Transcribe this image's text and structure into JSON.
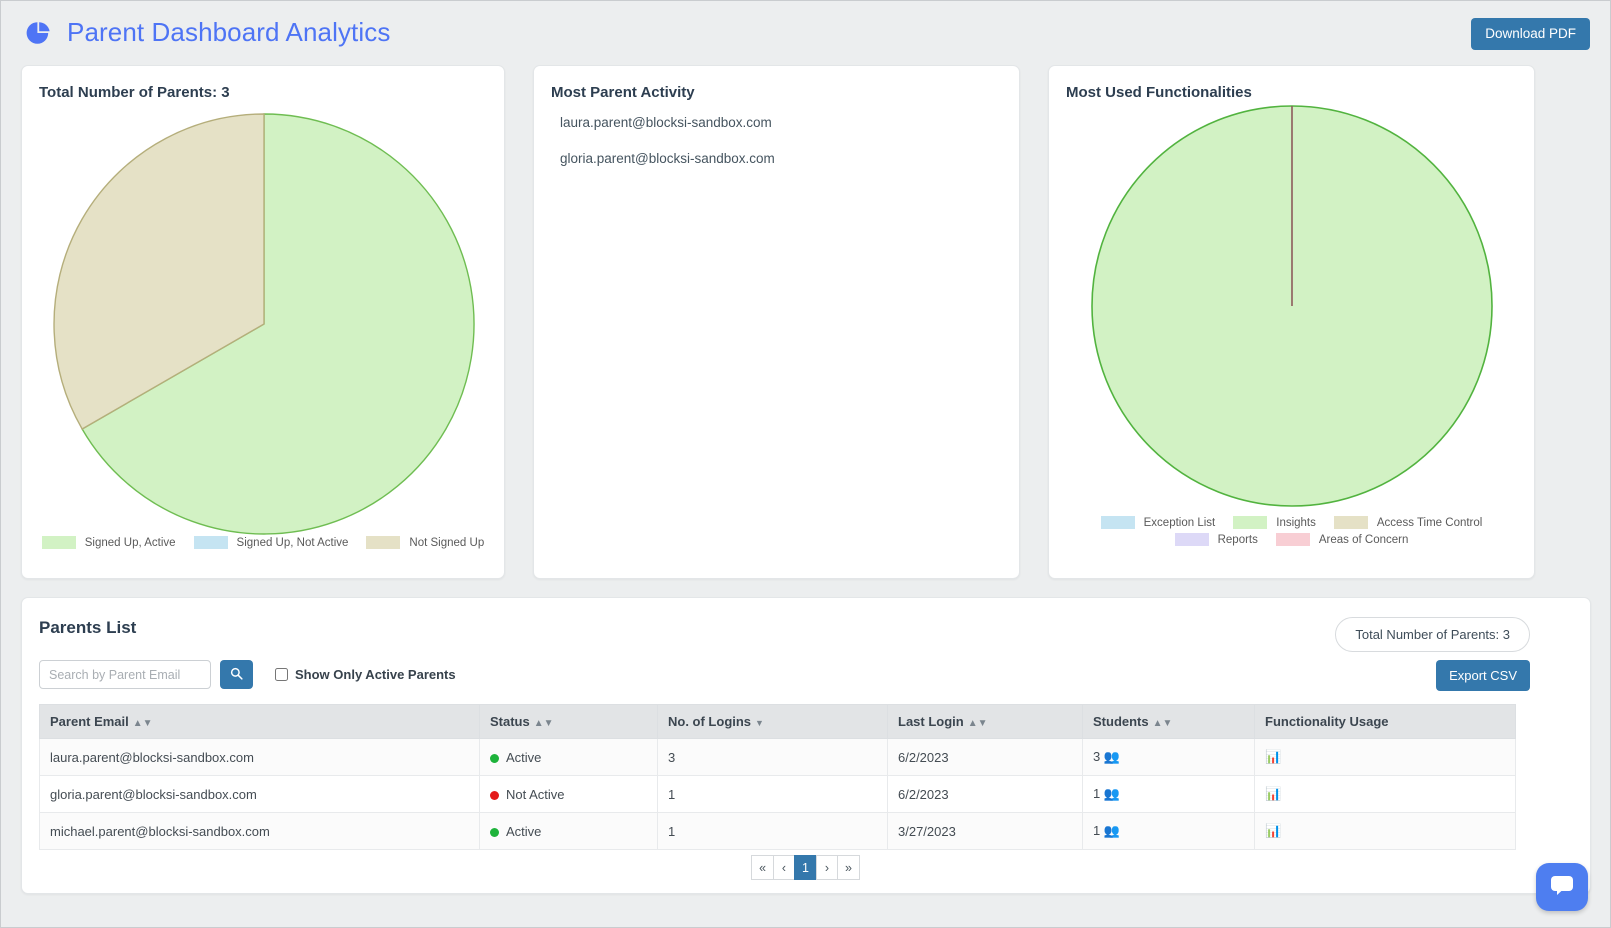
{
  "header": {
    "title": "Parent Dashboard Analytics",
    "brand_icon": "pie-chart-icon",
    "download_pdf_label": "Download PDF",
    "title_color": "#4e74f5",
    "button_color": "#3478ac"
  },
  "cards": {
    "parents_pie": {
      "title": "Total Number of Parents: 3"
    },
    "activity": {
      "title": "Most Parent Activity",
      "items": [
        "laura.parent@blocksi-sandbox.com",
        "gloria.parent@blocksi-sandbox.com"
      ]
    },
    "functionalities_pie": {
      "title": "Most Used Functionalities"
    }
  },
  "chart_data": [
    {
      "type": "pie",
      "title": "Total Number of Parents: 3",
      "labels": [
        "Signed Up, Active",
        "Signed Up, Not Active",
        "Not Signed Up"
      ],
      "values": [
        2,
        0,
        1
      ],
      "percentages": [
        66.7,
        0,
        33.3
      ],
      "colors": [
        "#d2f2c4",
        "#c5e4f2",
        "#e5e1c6"
      ],
      "border_colors": [
        "#6fbd52",
        "#6aa9c9",
        "#b5ae7b"
      ],
      "legend_position": "bottom",
      "total": 3
    },
    {
      "type": "pie",
      "title": "Most Used Functionalities",
      "labels": [
        "Exception List",
        "Insights",
        "Access Time Control",
        "Reports",
        "Areas of Concern"
      ],
      "values": [
        0,
        1,
        0,
        0,
        0
      ],
      "percentages": [
        0,
        100,
        0,
        0,
        0
      ],
      "colors": [
        "#c5e4f2",
        "#d2f2c4",
        "#e5e1c6",
        "#ddd9f7",
        "#f8ced4"
      ],
      "border_colors": [
        "#6aa9c9",
        "#52b33f",
        "#b5ae7b",
        "#9b93d6",
        "#d98d97"
      ],
      "legend_position": "bottom"
    }
  ],
  "parents_list": {
    "title": "Parents List",
    "total_pill": "Total Number of Parents: 3",
    "search_placeholder": "Search by Parent Email",
    "search_value": "",
    "search_icon": "search-icon",
    "active_only_label": "Show Only Active Parents",
    "active_only_checked": false,
    "export_label": "Export CSV",
    "columns": [
      {
        "label": "Parent Email",
        "sort": "both"
      },
      {
        "label": "Status",
        "sort": "both"
      },
      {
        "label": "No. of Logins",
        "sort": "desc"
      },
      {
        "label": "Last Login",
        "sort": "both"
      },
      {
        "label": "Students",
        "sort": "both"
      },
      {
        "label": "Functionality Usage",
        "sort": "none"
      }
    ],
    "rows": [
      {
        "email": "laura.parent@blocksi-sandbox.com",
        "status": "Active",
        "status_type": "active",
        "logins": "3",
        "last_login": "6/2/2023",
        "students": "3",
        "usage_icon": "bar-chart-icon"
      },
      {
        "email": "gloria.parent@blocksi-sandbox.com",
        "status": "Not Active",
        "status_type": "inactive",
        "logins": "1",
        "last_login": "6/2/2023",
        "students": "1",
        "usage_icon": "bar-chart-icon"
      },
      {
        "email": "michael.parent@blocksi-sandbox.com",
        "status": "Active",
        "status_type": "active",
        "logins": "1",
        "last_login": "3/27/2023",
        "students": "1",
        "usage_icon": "bar-chart-icon"
      }
    ],
    "pagination": {
      "first": "«",
      "prev": "‹",
      "pages": [
        "1"
      ],
      "current": "1",
      "next": "›",
      "last": "»"
    }
  },
  "chat": {
    "icon": "chat-icon"
  }
}
